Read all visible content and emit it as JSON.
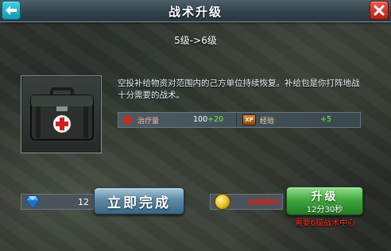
{
  "header": {
    "title": "战术升级"
  },
  "level": {
    "text": "5级->6级"
  },
  "item": {
    "name_icon": "medkit-icon"
  },
  "description": "空投补给物资对范围内的己方单位持续恢复。补给包是你打阵地战十分需要的战术。",
  "stats": {
    "heal_label": "治疗量",
    "heal_value": "100",
    "heal_bonus": "+20",
    "exp_icon_text": "XP",
    "exp_label": "经验",
    "exp_bonus": "+5"
  },
  "gems": {
    "count": "12"
  },
  "complete_button": {
    "label": "立即完成"
  },
  "gold": {
    "cost": "20000"
  },
  "upgrade_button": {
    "label": "升级",
    "time": "12分30秒"
  },
  "requirement": "需要6级战术中心",
  "colors": {
    "accent_cyan": "#1598b0",
    "close_red": "#b51d14",
    "upgrade_green": "#3ea33c",
    "cost_red": "#e01c14"
  }
}
